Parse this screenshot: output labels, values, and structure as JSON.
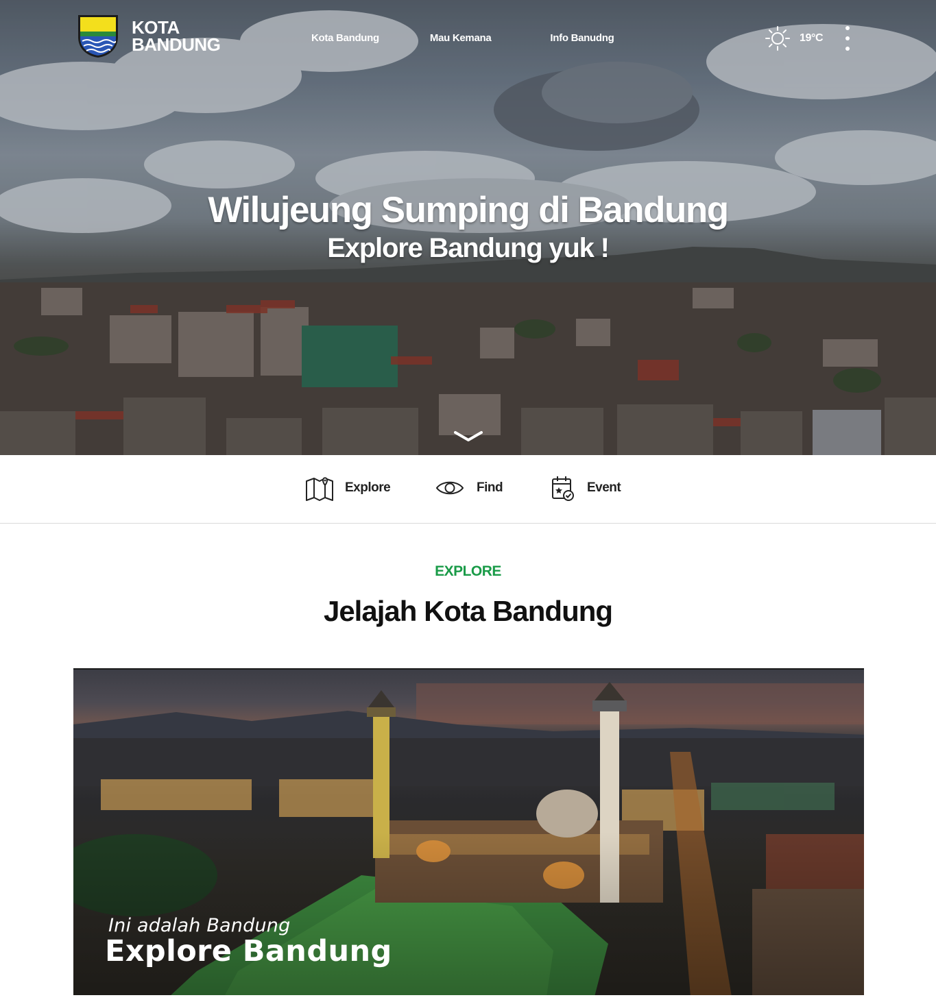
{
  "header": {
    "logo_line1": "KOTA",
    "logo_line2": "BANDUNG",
    "nav": [
      {
        "label": "Kota Bandung"
      },
      {
        "label": "Mau Kemana"
      },
      {
        "label": "Info Banudng"
      }
    ],
    "weather": {
      "icon": "sun-icon",
      "temperature": "19°C"
    },
    "menu_icon": "kebab-menu-icon"
  },
  "hero": {
    "title": "Wilujeung Sumping di Bandung",
    "subtitle": "Explore Bandung yuk !",
    "scroll_icon": "chevron-down-icon"
  },
  "quick_nav": [
    {
      "label": "Explore",
      "icon": "map-pin-icon"
    },
    {
      "label": "Find",
      "icon": "eye-icon"
    },
    {
      "label": "Event",
      "icon": "calendar-check-icon"
    }
  ],
  "explore": {
    "kicker": "EXPLORE",
    "title": "Jelajah Kota Bandung",
    "feature": {
      "kicker": "Ini adalah Bandung",
      "title": "Explore Bandung"
    }
  },
  "colors": {
    "accent_green": "#1a9b48",
    "text_dark": "#111111",
    "divider": "#d9d9d9"
  }
}
